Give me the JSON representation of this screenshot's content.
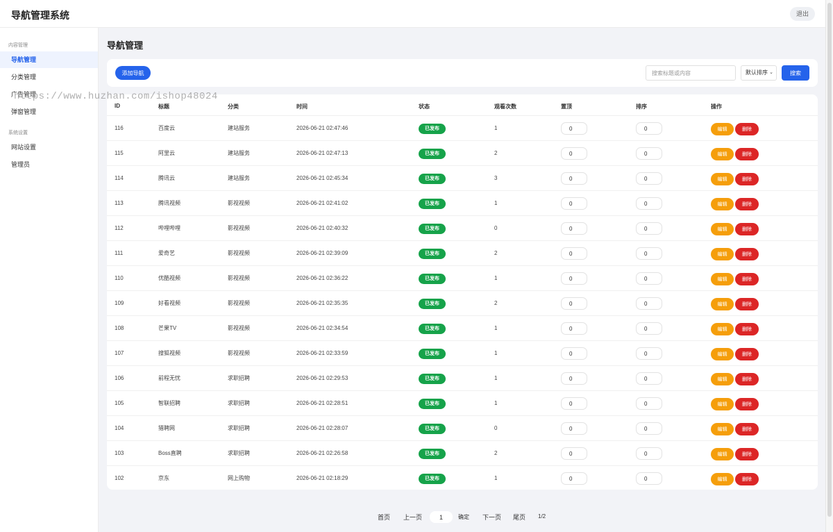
{
  "header": {
    "title": "导航管理系统",
    "logout_label": "退出"
  },
  "sidebar": {
    "groups": [
      {
        "title": "内容管理",
        "items": [
          {
            "label": "导航管理",
            "active": true
          },
          {
            "label": "分类管理"
          },
          {
            "label": "广告管理"
          },
          {
            "label": "弹窗管理"
          }
        ]
      },
      {
        "title": "系统设置",
        "items": [
          {
            "label": "网站设置"
          },
          {
            "label": "管理员"
          }
        ]
      }
    ]
  },
  "watermark": "https://www.huzhan.com/ishop48024",
  "page": {
    "title": "导航管理"
  },
  "toolbar": {
    "add_label": "添加导航",
    "search_placeholder": "搜索标题或内容",
    "sort_value": "默认排序",
    "search_label": "搜索"
  },
  "table": {
    "columns": [
      "ID",
      "标题",
      "分类",
      "时间",
      "状态",
      "观看次数",
      "置顶",
      "排序",
      "操作"
    ],
    "edit_label": "编辑",
    "delete_label": "删除",
    "rows": [
      {
        "id": "116",
        "title": "百度云",
        "category": "建站服务",
        "time": "2026-06-21 02:47:46",
        "status": "已发布",
        "views": "1",
        "top": "0",
        "sort": "0"
      },
      {
        "id": "115",
        "title": "阿里云",
        "category": "建站服务",
        "time": "2026-06-21 02:47:13",
        "status": "已发布",
        "views": "2",
        "top": "0",
        "sort": "0"
      },
      {
        "id": "114",
        "title": "腾讯云",
        "category": "建站服务",
        "time": "2026-06-21 02:45:34",
        "status": "已发布",
        "views": "3",
        "top": "0",
        "sort": "0"
      },
      {
        "id": "113",
        "title": "腾讯视频",
        "category": "影视视频",
        "time": "2026-06-21 02:41:02",
        "status": "已发布",
        "views": "1",
        "top": "0",
        "sort": "0"
      },
      {
        "id": "112",
        "title": "哔哩哔哩",
        "category": "影视视频",
        "time": "2026-06-21 02:40:32",
        "status": "已发布",
        "views": "0",
        "top": "0",
        "sort": "0"
      },
      {
        "id": "111",
        "title": "爱奇艺",
        "category": "影视视频",
        "time": "2026-06-21 02:39:09",
        "status": "已发布",
        "views": "2",
        "top": "0",
        "sort": "0"
      },
      {
        "id": "110",
        "title": "优酷视频",
        "category": "影视视频",
        "time": "2026-06-21 02:36:22",
        "status": "已发布",
        "views": "1",
        "top": "0",
        "sort": "0"
      },
      {
        "id": "109",
        "title": "好看视频",
        "category": "影视视频",
        "time": "2026-06-21 02:35:35",
        "status": "已发布",
        "views": "2",
        "top": "0",
        "sort": "0"
      },
      {
        "id": "108",
        "title": "芒果TV",
        "category": "影视视频",
        "time": "2026-06-21 02:34:54",
        "status": "已发布",
        "views": "1",
        "top": "0",
        "sort": "0"
      },
      {
        "id": "107",
        "title": "搜狐视频",
        "category": "影视视频",
        "time": "2026-06-21 02:33:59",
        "status": "已发布",
        "views": "1",
        "top": "0",
        "sort": "0"
      },
      {
        "id": "106",
        "title": "前程无忧",
        "category": "求职招聘",
        "time": "2026-06-21 02:29:53",
        "status": "已发布",
        "views": "1",
        "top": "0",
        "sort": "0"
      },
      {
        "id": "105",
        "title": "智联招聘",
        "category": "求职招聘",
        "time": "2026-06-21 02:28:51",
        "status": "已发布",
        "views": "1",
        "top": "0",
        "sort": "0"
      },
      {
        "id": "104",
        "title": "猎聘网",
        "category": "求职招聘",
        "time": "2026-06-21 02:28:07",
        "status": "已发布",
        "views": "0",
        "top": "0",
        "sort": "0"
      },
      {
        "id": "103",
        "title": "Boss直聘",
        "category": "求职招聘",
        "time": "2026-06-21 02:26:58",
        "status": "已发布",
        "views": "2",
        "top": "0",
        "sort": "0"
      },
      {
        "id": "102",
        "title": "京东",
        "category": "网上购物",
        "time": "2026-06-21 02:18:29",
        "status": "已发布",
        "views": "1",
        "top": "0",
        "sort": "0"
      }
    ]
  },
  "pagination": {
    "first": "首页",
    "prev": "上一页",
    "page_input": "1",
    "confirm": "确定",
    "next": "下一页",
    "last": "尾页",
    "status": "1/2"
  },
  "colors": {
    "primary": "#2563eb",
    "published": "#16a34a",
    "edit": "#f59e0b",
    "delete": "#dc2626"
  }
}
